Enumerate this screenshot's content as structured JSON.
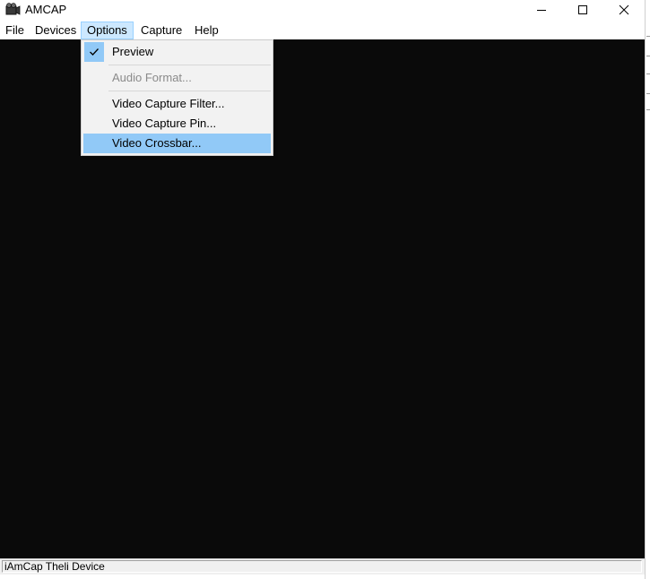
{
  "window": {
    "title": "AMCAP",
    "icon": "camera-icon"
  },
  "caption_buttons": {
    "minimize": "minimize-icon",
    "maximize": "maximize-icon",
    "close": "close-icon"
  },
  "menubar": {
    "items": [
      {
        "label": "File"
      },
      {
        "label": "Devices"
      },
      {
        "label": "Options"
      },
      {
        "label": "Capture"
      },
      {
        "label": "Help"
      }
    ]
  },
  "options_menu": {
    "items": [
      {
        "label": "Preview",
        "checked": true,
        "enabled": true
      },
      {
        "label": "Audio Format...",
        "enabled": false
      },
      {
        "label": "Video Capture Filter...",
        "enabled": true
      },
      {
        "label": "Video Capture Pin...",
        "enabled": true
      },
      {
        "label": "Video Crossbar...",
        "enabled": true,
        "highlighted": true
      }
    ],
    "highlight_color": "#91c9f7"
  },
  "statusbar": {
    "text": "iAmCap Theli Device"
  },
  "colors": {
    "video_background": "#0a0a0a",
    "menu_active_background": "#cce8ff"
  }
}
